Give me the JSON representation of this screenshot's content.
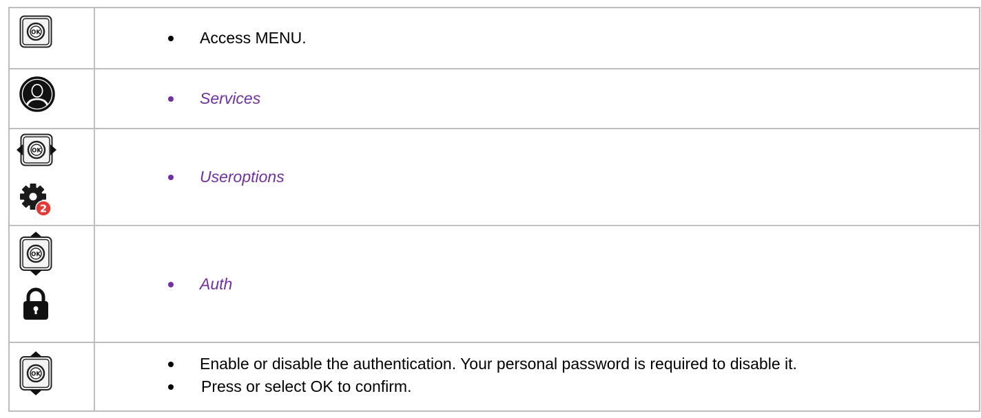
{
  "colors": {
    "menu_item": "#7030a0",
    "border": "#bdbdbd",
    "badge": "#e53935"
  },
  "rows": [
    {
      "icons": [
        "ok-key-icon"
      ],
      "steps": [
        {
          "text": "Access MENU.",
          "style": "normal"
        }
      ]
    },
    {
      "icons": [
        "user-profile-icon"
      ],
      "steps": [
        {
          "text": "Services",
          "style": "menu"
        }
      ]
    },
    {
      "icons": [
        "navigator-left-right-icon",
        "settings-gear-icon"
      ],
      "badge": "2",
      "steps": [
        {
          "text": "Useroptions",
          "style": "menu"
        }
      ]
    },
    {
      "icons": [
        "navigator-up-down-icon",
        "padlock-icon"
      ],
      "steps": [
        {
          "text": "Auth",
          "style": "menu"
        }
      ]
    },
    {
      "icons": [
        "navigator-up-down-icon"
      ],
      "steps": [
        {
          "text": "Enable or disable the authentication. Your personal password is required to disable it.",
          "style": "normal"
        },
        {
          "text": "Press or select OK to confirm.",
          "style": "normal"
        }
      ]
    }
  ]
}
